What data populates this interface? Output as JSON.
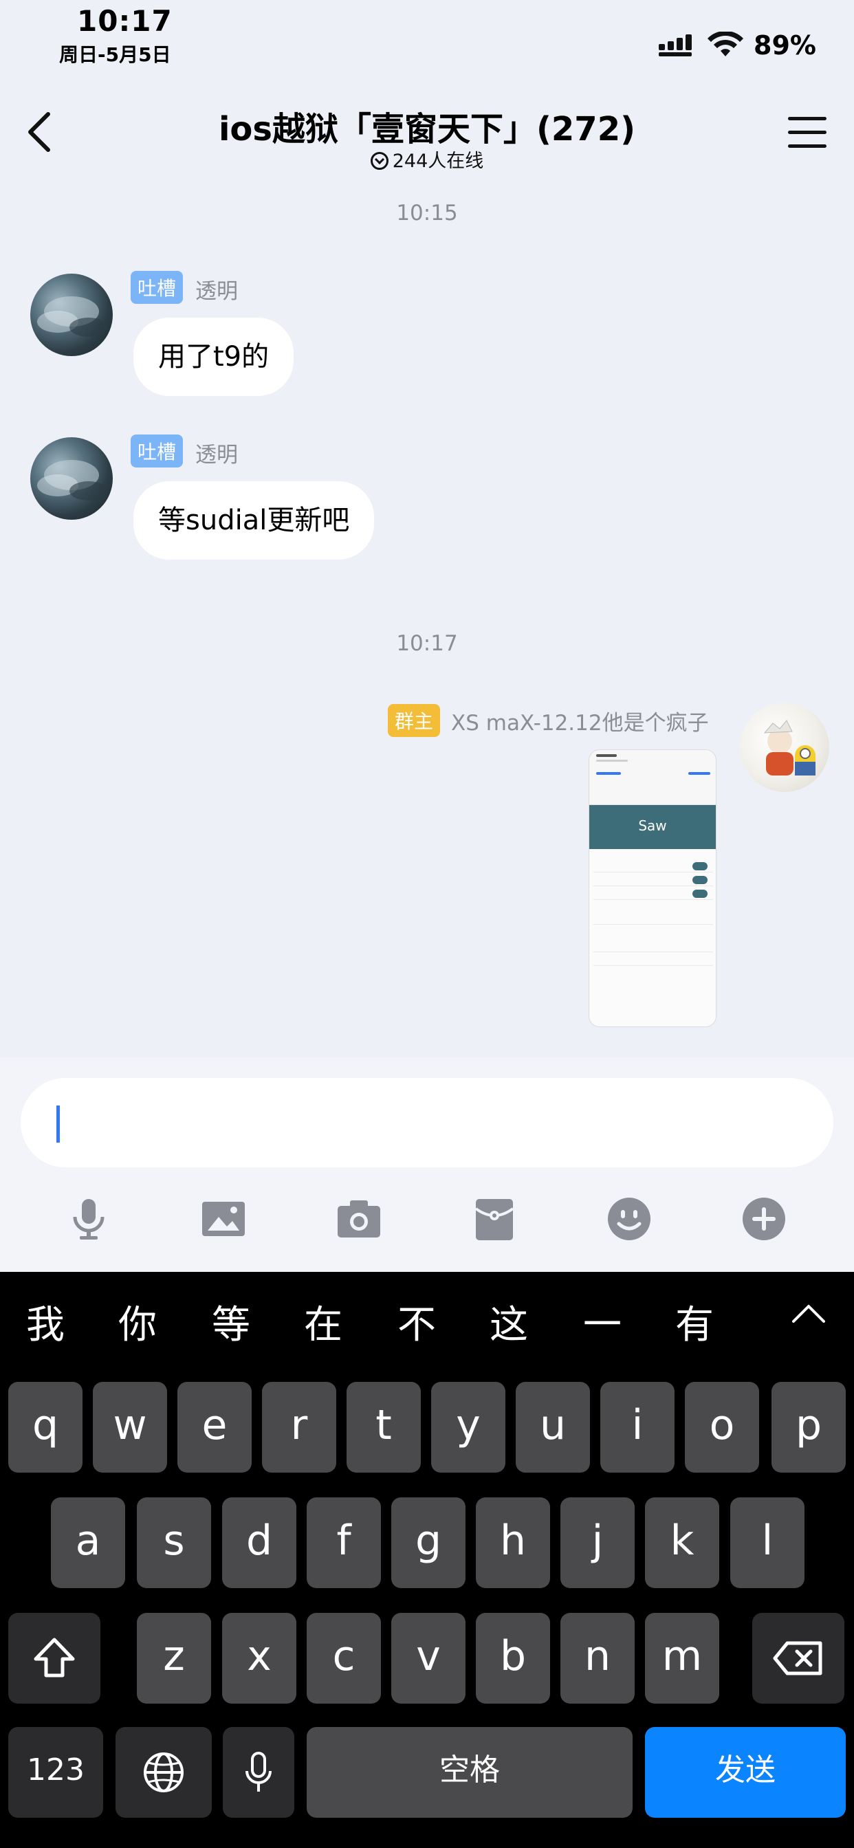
{
  "status": {
    "time": "10:17",
    "date": "周日-5月5日",
    "battery": "89%"
  },
  "nav": {
    "title": "ios越狱「壹窗天下」(272)",
    "online": "244人在线"
  },
  "messages": [
    {
      "time": "10:15"
    },
    {
      "badge": "吐槽",
      "sender": "透明",
      "text": "用了t9的"
    },
    {
      "badge": "吐槽",
      "sender": "透明",
      "text": "等sudial更新吧"
    },
    {
      "time": "10:17"
    },
    {
      "badge": "群主",
      "sender": "XS maX-12.12他是个疯子",
      "image_title": "Saw"
    }
  ],
  "toolbar": [
    "microphone-icon",
    "image-icon",
    "camera-icon",
    "red-packet-icon",
    "emoji-icon",
    "plus-icon"
  ],
  "keyboard": {
    "candidates": [
      "我",
      "你",
      "等",
      "在",
      "不",
      "这",
      "一",
      "有"
    ],
    "row1": [
      "q",
      "w",
      "e",
      "r",
      "t",
      "y",
      "u",
      "i",
      "o",
      "p"
    ],
    "row2": [
      "a",
      "s",
      "d",
      "f",
      "g",
      "h",
      "j",
      "k",
      "l"
    ],
    "row3": [
      "z",
      "x",
      "c",
      "v",
      "b",
      "n",
      "m"
    ],
    "numbers_key": "123",
    "space_key": "空格",
    "send_key": "发送"
  },
  "colors": {
    "accent": "#0a84ff",
    "badge_blue": "#7bb5f7",
    "badge_gold": "#f4bd38",
    "background": "#eef0f7"
  }
}
